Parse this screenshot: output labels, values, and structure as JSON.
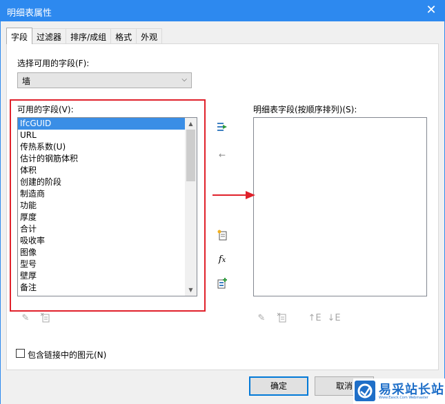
{
  "window": {
    "title": "明细表属性",
    "close_glyph": "✕"
  },
  "tabs": [
    "字段",
    "过滤器",
    "排序/成组",
    "格式",
    "外观"
  ],
  "fields": {
    "select_label": "选择可用的字段(F):",
    "select_value": "墙",
    "available_label": "可用的字段(V):",
    "available_items": [
      "IfcGUID",
      "URL",
      "传热系数(U)",
      "估计的钢筋体积",
      "体积",
      "创建的阶段",
      "制造商",
      "功能",
      "厚度",
      "合计",
      "吸收率",
      "图像",
      "型号",
      "壁厚",
      "备注"
    ],
    "selected_item": "IfcGUID",
    "schedule_label": "明细表字段(按顺序排列)(S):",
    "include_linked_label": "包含链接中的图元(N)",
    "include_linked_checked": false
  },
  "buttons": {
    "ok": "确定",
    "cancel": "取消"
  },
  "watermark": {
    "text": "易采站长站",
    "sub": "Www.Easck.Com   Webmaster"
  },
  "colors": {
    "titlebar": "#2d89ef",
    "highlight_box": "#e0202a",
    "selection": "#3a8ee6",
    "primary_button_border": "#0078d7"
  }
}
